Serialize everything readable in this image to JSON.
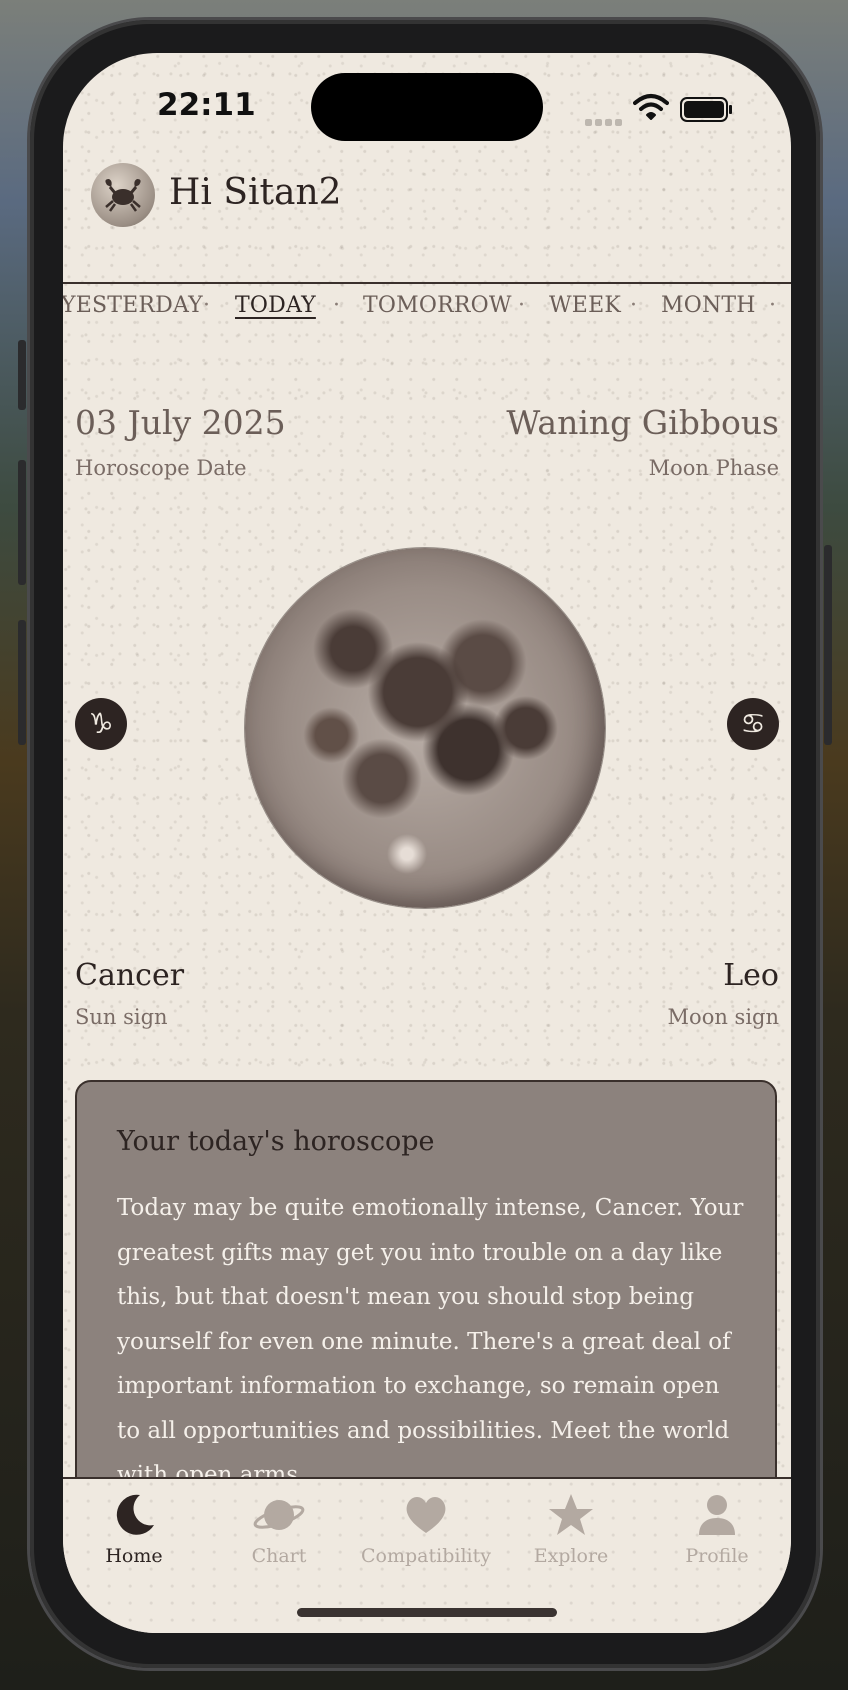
{
  "status_bar": {
    "time": "22:11"
  },
  "header": {
    "greeting": "Hi Sitan2"
  },
  "period_tabs": {
    "items": [
      "YESTERDAY",
      "TODAY",
      "TOMORROW",
      "WEEK",
      "MONTH"
    ],
    "active": "TODAY",
    "separator": "·"
  },
  "horoscope_date": {
    "value": "03 July 2025",
    "label": "Horoscope Date"
  },
  "moon_phase": {
    "value": "Waning Gibbous",
    "label": "Moon Phase"
  },
  "zodiac_glyphs": {
    "left": "♑",
    "right": "♋"
  },
  "sun_sign": {
    "value": "Cancer",
    "label": "Sun sign"
  },
  "moon_sign": {
    "value": "Leo",
    "label": "Moon sign"
  },
  "horoscope_card": {
    "title": "Your today's horoscope",
    "body": "Today may be quite emotionally intense, Cancer. Your greatest gifts may get you into trouble on a day like this, but that doesn't mean you should stop being yourself for even one minute. There's a great deal of important information to exchange, so remain open to all opportunities and possibilities. Meet the world with open arms."
  },
  "tab_bar": {
    "items": [
      {
        "label": "Home",
        "icon": "moon-icon",
        "active": true
      },
      {
        "label": "Chart",
        "icon": "planet-icon",
        "active": false
      },
      {
        "label": "Compatibility",
        "icon": "heart-icon",
        "active": false
      },
      {
        "label": "Explore",
        "icon": "star-icon",
        "active": false
      },
      {
        "label": "Profile",
        "icon": "person-icon",
        "active": false
      }
    ]
  },
  "colors": {
    "background": "#efe9e0",
    "text_dark": "#2d2422",
    "text_muted": "#7a6c66",
    "card": "#8c827d",
    "tab_inactive": "#b3a9a1"
  }
}
